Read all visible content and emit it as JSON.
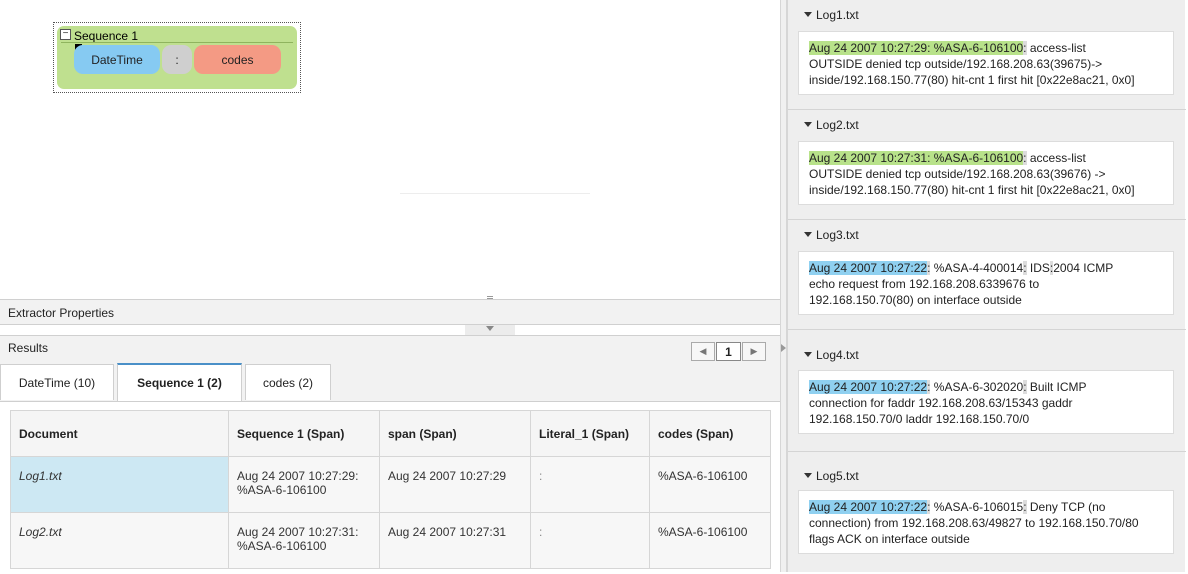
{
  "canvas": {
    "sequence_title": "Sequence 1",
    "toggle_symbol": "−",
    "chips": {
      "datetime": "DateTime",
      "literal": ":",
      "codes": "codes"
    }
  },
  "extractor_properties": {
    "title": "Extractor Properties"
  },
  "results": {
    "title": "Results",
    "pager": {
      "prev": "◀",
      "page": "1",
      "next": "▶"
    },
    "tabs": [
      {
        "label": "DateTime (10)",
        "selected": false
      },
      {
        "label": "Sequence 1 (2)",
        "selected": true
      },
      {
        "label": "codes (2)",
        "selected": false
      }
    ],
    "table": {
      "headers": [
        "Document",
        "Sequence 1 (Span)",
        "span (Span)",
        "Literal_1 (Span)",
        "codes (Span)"
      ],
      "rows": [
        {
          "doc": "Log1.txt",
          "seq_line1": "Aug 24 2007 10:27:29:",
          "seq_line2": "%ASA-6-106100",
          "span": "Aug 24 2007 10:27:29",
          "literal": ":",
          "codes": "%ASA-6-106100",
          "selected": true
        },
        {
          "doc": "Log2.txt",
          "seq_line1": "Aug 24 2007 10:27:31:",
          "seq_line2": "%ASA-6-106100",
          "span": "Aug 24 2007 10:27:31",
          "literal": ":",
          "codes": "%ASA-6-106100",
          "selected": false
        }
      ]
    }
  },
  "logs": [
    {
      "name": "Log1.txt",
      "highlight": "Aug 24 2007 10:27:29: %ASA-6-106100",
      "sep": ":",
      "text": [
        " access-list",
        "OUTSIDE denied tcp outside/192.168.208.63(39675)->",
        "inside/192.168.150.77(80) hit-cnt 1 first hit [0x22e8ac21, 0x0]"
      ]
    },
    {
      "name": "Log2.txt",
      "highlight": "Aug 24 2007 10:27:31: %ASA-6-106100",
      "sep": ":",
      "text": [
        " access-list",
        "OUTSIDE denied tcp outside/192.168.208.63(39676) ->",
        "inside/192.168.150.77(80) hit-cnt 1 first hit [0x22e8ac21, 0x0]"
      ]
    },
    {
      "name": "Log3.txt",
      "highlight": "Aug 24 2007 10:27:22",
      "sep1": ":",
      "code": " %ASA-4-400014",
      "sep2": ":",
      "mid": " IDS",
      "sep3": ":",
      "text": [
        "2004 ICMP",
        "echo request from 192.168.208.6339676 to",
        "192.168.150.70(80) on interface outside"
      ]
    },
    {
      "name": "Log4.txt",
      "highlight": "Aug 24 2007 10:27:22",
      "sep1": ":",
      "code": " %ASA-6-302020",
      "sep2": ":",
      "text": [
        " Built ICMP",
        "connection for faddr 192.168.208.63/15343 gaddr",
        "192.168.150.70/0 laddr 192.168.150.70/0"
      ]
    },
    {
      "name": "Log5.txt",
      "highlight": "Aug 24 2007 10:27:22",
      "sep1": ":",
      "code": " %ASA-6-106015",
      "sep2": ":",
      "text": [
        " Deny TCP (no",
        "connection) from 192.168.208.63/49827 to 192.168.150.70/80",
        "flags ACK on interface outside"
      ]
    }
  ]
}
